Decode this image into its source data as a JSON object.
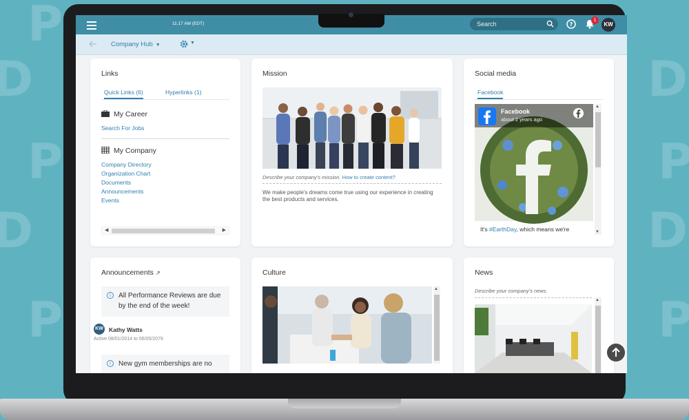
{
  "topbar": {
    "time": "11:17 AM (EDT)",
    "search_placeholder": "Search",
    "notification_count": "1",
    "user_initials": "KW",
    "accent_color": "#3f8ea6"
  },
  "subbar": {
    "hub_title": "Company Hub"
  },
  "links_card": {
    "title": "Links",
    "tabs": [
      "Quick Links (6)",
      "Hyperlinks (1)"
    ],
    "career": {
      "title": "My Career",
      "links": [
        "Search For Jobs"
      ]
    },
    "company": {
      "title": "My Company",
      "links": [
        "Company Directory",
        "Organization Chart",
        "Documents",
        "Announcements",
        "Events"
      ]
    }
  },
  "mission_card": {
    "title": "Mission",
    "caption": "Describe your company's mission.",
    "caption_link": "How to create content?",
    "body": "We make people's dreams come true using our experience in creating the best products and services."
  },
  "social_card": {
    "title": "Social media",
    "tab": "Facebook",
    "page_name": "Facebook",
    "post_age": "about 2 years ago",
    "post_text_prefix": "It's ",
    "post_hashtag": "#EarthDay",
    "post_text_suffix": ", which means we're"
  },
  "announcements_card": {
    "title": "Announcements",
    "items": [
      "All Performance Reviews are due by the end of the week!",
      "New gym memberships are no"
    ],
    "author_initials": "KW",
    "author_name": "Kathy Watts",
    "author_dates": "Active 08/01/2014 to 06/05/2079"
  },
  "culture_card": {
    "title": "Culture"
  },
  "news_card": {
    "title": "News",
    "caption": "Describe your company's news."
  },
  "icons": [
    "menu-icon",
    "search-icon",
    "help-icon",
    "bell-icon",
    "back-arrow-icon",
    "gear-icon",
    "briefcase-icon",
    "building-icon",
    "info-icon",
    "external-link-icon",
    "arrow-up-icon",
    "facebook-icon"
  ]
}
